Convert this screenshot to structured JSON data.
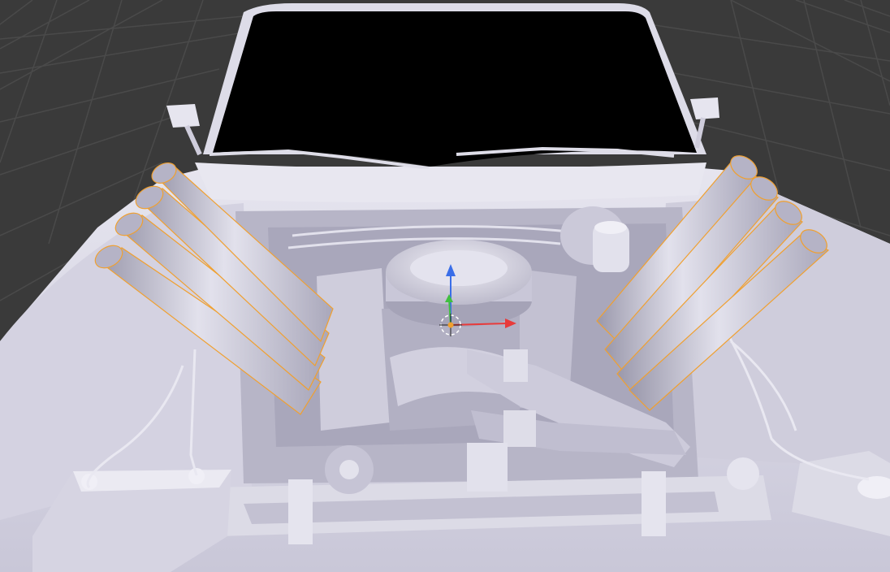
{
  "viewport": {
    "background_color": "#3a3a3a",
    "grid_line_color": "#4a4a4a",
    "model_base_color": "#d3d1df",
    "model_shadow_color": "#8f8da0",
    "model_highlight_color": "#eeedf5",
    "windshield_color": "#000000",
    "selection_outline_color": "#f0a030"
  },
  "selection": {
    "selected_object": "exhaust-headers",
    "outline_color": "#f0a030"
  },
  "gizmo": {
    "type": "translate",
    "x_axis_color": "#e83a3a",
    "y_axis_color": "#40c040",
    "z_axis_color": "#3a6ee8",
    "origin_color": "#f0a030"
  }
}
